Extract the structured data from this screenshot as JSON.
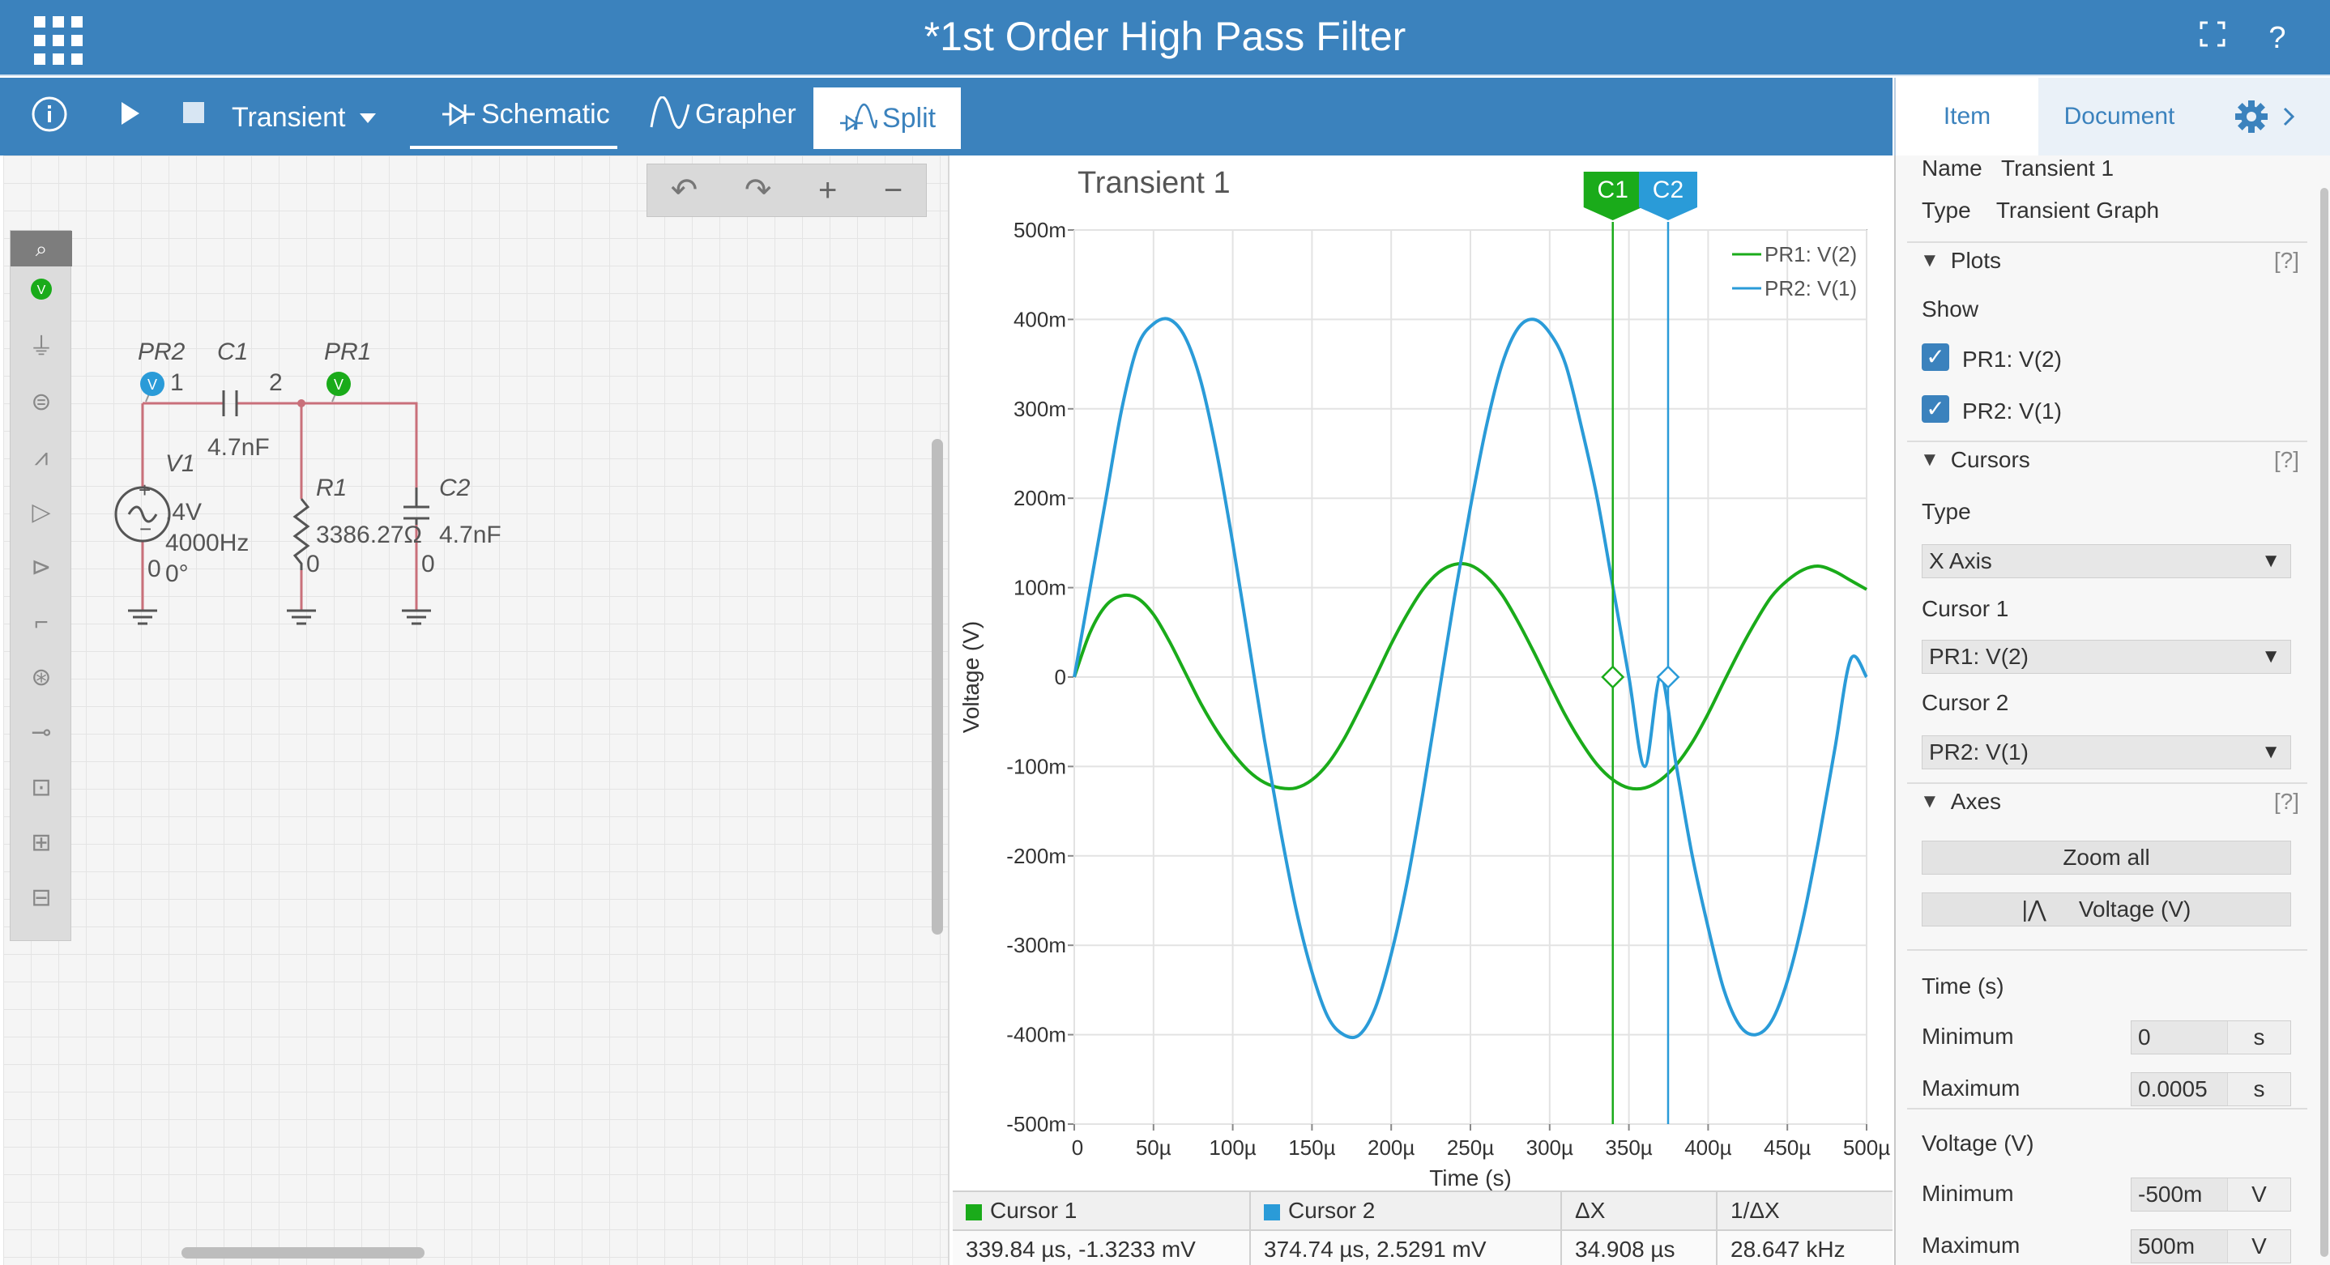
{
  "app": {
    "title": "*1st Order High Pass Filter",
    "fullscreen_icon": "fullscreen-icon",
    "help_label": "?"
  },
  "toolbar": {
    "analysis": "Transient",
    "schematic": "Schematic",
    "grapher": "Grapher",
    "split": "Split"
  },
  "right_tabs": {
    "item": "Item",
    "document": "Document"
  },
  "schematic": {
    "labels": {
      "pr2": "PR2",
      "pr1": "PR1",
      "c1": "C1",
      "c1_value": "4.7nF",
      "node1": "1",
      "node2": "2",
      "v1": "V1",
      "v1_amp": ".4V",
      "v1_freq": "4000Hz",
      "v1_phase": "0°",
      "v1_gnd": "0",
      "r1": "R1",
      "r1_value": "3386.27Ω",
      "r1_gnd": "0",
      "c2": "C2",
      "c2_value": "4.7nF",
      "c2_gnd": "0"
    }
  },
  "graph": {
    "title": "Transient 1",
    "cursor1_label": "C1",
    "cursor2_label": "C2"
  },
  "chart_data": {
    "type": "line",
    "title": "Transient 1",
    "xlabel": "Time (s)",
    "ylabel": "Voltage (V)",
    "xlim": [
      0,
      0.0005
    ],
    "ylim": [
      -0.5,
      0.5
    ],
    "x_ticks": [
      0,
      5e-05,
      0.0001,
      0.00015,
      0.0002,
      0.00025,
      0.0003,
      0.00035,
      0.0004,
      0.00045,
      0.0005
    ],
    "x_tick_labels": [
      "0",
      "50µ",
      "100µ",
      "150µ",
      "200µ",
      "250µ",
      "300µ",
      "350µ",
      "400µ",
      "450µ",
      "500µ"
    ],
    "y_ticks": [
      0.5,
      0.4,
      0.3,
      0.2,
      0.1,
      0,
      -0.1,
      -0.2,
      -0.3,
      -0.4,
      -0.5
    ],
    "y_tick_labels": [
      "500m",
      "400m",
      "300m",
      "200m",
      "100m",
      "0",
      "-100m",
      "-200m",
      "-300m",
      "-400m",
      "-500m"
    ],
    "grid": true,
    "legend": "top-right",
    "cursors": [
      {
        "label": "C1",
        "x": 0.00033984,
        "color": "#1aab1a"
      },
      {
        "label": "C2",
        "x": 0.00037474,
        "color": "#2a9bd8"
      }
    ],
    "series": [
      {
        "name": "PR1: V(2)",
        "color": "#1aab1a",
        "x": [
          0,
          1e-05,
          2e-05,
          3e-05,
          4e-05,
          5e-05,
          6e-05,
          7e-05,
          8e-05,
          9e-05,
          0.0001,
          0.00011,
          0.00012,
          0.00013,
          0.00014,
          0.00015,
          0.00016,
          0.00017,
          0.00018,
          0.00019,
          0.0002,
          0.00021,
          0.00022,
          0.00023,
          0.00024,
          0.00025,
          0.00026,
          0.00027,
          0.00028,
          0.00029,
          0.0003,
          0.00031,
          0.00032,
          0.00033,
          0.00034,
          0.00035,
          0.00036,
          0.00037,
          0.00038,
          0.00039,
          0.0004,
          0.00041,
          0.00042,
          0.00043,
          0.00044,
          0.00045,
          0.00046,
          0.00047,
          0.00048,
          0.00049,
          0.0005
        ],
        "y": [
          0,
          0.05,
          0.08,
          0.091,
          0.088,
          0.07,
          0.04,
          0.005,
          -0.03,
          -0.06,
          -0.085,
          -0.105,
          -0.118,
          -0.124,
          -0.124,
          -0.115,
          -0.097,
          -0.07,
          -0.036,
          0,
          0.037,
          0.07,
          0.098,
          0.117,
          0.126,
          0.125,
          0.113,
          0.092,
          0.062,
          0.028,
          -0.008,
          -0.043,
          -0.073,
          -0.098,
          -0.115,
          -0.124,
          -0.124,
          -0.115,
          -0.098,
          -0.073,
          -0.041,
          -0.005,
          0.03,
          0.062,
          0.09,
          0.108,
          0.12,
          0.124,
          0.118,
          0.108,
          0.098
        ]
      },
      {
        "name": "PR2: V(1)",
        "color": "#2a9bd8",
        "x": [
          0,
          1e-05,
          2e-05,
          3e-05,
          4e-05,
          5e-05,
          6e-05,
          7e-05,
          8e-05,
          9e-05,
          0.0001,
          0.00011,
          0.00012,
          0.00013,
          0.00014,
          0.00015,
          0.00016,
          0.00017,
          0.00018,
          0.00019,
          0.0002,
          0.00021,
          0.00022,
          0.00023,
          0.00024,
          0.00025,
          0.00026,
          0.00027,
          0.00028,
          0.00029,
          0.0003,
          0.00031,
          0.00032,
          0.00033,
          0.00034,
          0.00035,
          0.00036,
          0.00037,
          0.00038,
          0.00039,
          0.0004,
          0.00041,
          0.00042,
          0.00043,
          0.00044,
          0.00045,
          0.00046,
          0.00047,
          0.00048,
          0.00049,
          0.0005
        ],
        "y": [
          0,
          0.1,
          0.2,
          0.3,
          0.37,
          0.395,
          0.4,
          0.38,
          0.33,
          0.25,
          0.15,
          0.04,
          -0.07,
          -0.17,
          -0.26,
          -0.33,
          -0.38,
          -0.4,
          -0.4,
          -0.37,
          -0.31,
          -0.23,
          -0.13,
          -0.02,
          0.09,
          0.19,
          0.28,
          0.35,
          0.39,
          0.4,
          0.385,
          0.35,
          0.28,
          0.2,
          0.1,
          -0.0,
          -0.1,
          0.0,
          -0.1,
          -0.2,
          -0.28,
          -0.35,
          -0.39,
          -0.4,
          -0.385,
          -0.34,
          -0.27,
          -0.18,
          -0.08,
          0.02,
          -0.0
        ]
      }
    ]
  },
  "cursor_table": {
    "headers": [
      "Cursor 1",
      "Cursor 2",
      "ΔX",
      "1/ΔX"
    ],
    "values": [
      "339.84 µs, -1.3233 mV",
      "374.74 µs, 2.5291 mV",
      "34.908 µs",
      "28.647 kHz"
    ]
  },
  "panel": {
    "name_label": "Name",
    "name_value": "Transient 1",
    "type_label": "Type",
    "type_value": "Transient Graph",
    "plots": "Plots",
    "help": "[?]",
    "show": "Show",
    "plot1": "PR1: V(2)",
    "plot2": "PR2: V(1)",
    "cursors": "Cursors",
    "cursor_type_label": "Type",
    "cursor_type": "X Axis",
    "cursor1_label": "Cursor 1",
    "cursor1": "PR1: V(2)",
    "cursor2_label": "Cursor 2",
    "cursor2": "PR2: V(1)",
    "axes": "Axes",
    "zoom_all": "Zoom all",
    "voltage_btn": "Voltage (V)",
    "time_label": "Time (s)",
    "min_label": "Minimum",
    "max_label": "Maximum",
    "time_min": "0",
    "time_max": "0.0005",
    "time_unit": "s",
    "voltage_label": "Voltage (V)",
    "v_min": "-500m",
    "v_max": "500m",
    "v_unit": "V"
  }
}
